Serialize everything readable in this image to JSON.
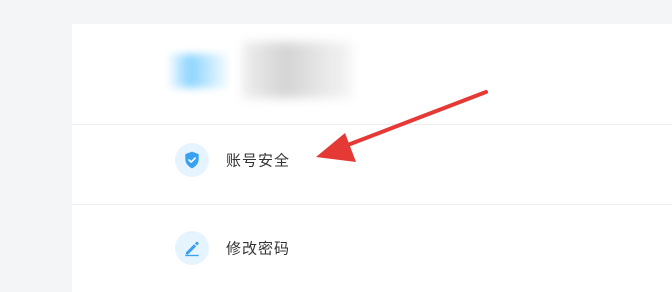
{
  "profile": {
    "avatar_icon": "avatar-blurred",
    "name_icon": "name-blurred"
  },
  "menu": {
    "items": [
      {
        "label": "账号安全",
        "icon": "shield-icon"
      },
      {
        "label": "修改密码",
        "icon": "pencil-icon"
      }
    ]
  },
  "colors": {
    "accent": "#3aa0f0",
    "icon_bg": "#e6f4ff",
    "annotation_arrow": "#e53935"
  }
}
